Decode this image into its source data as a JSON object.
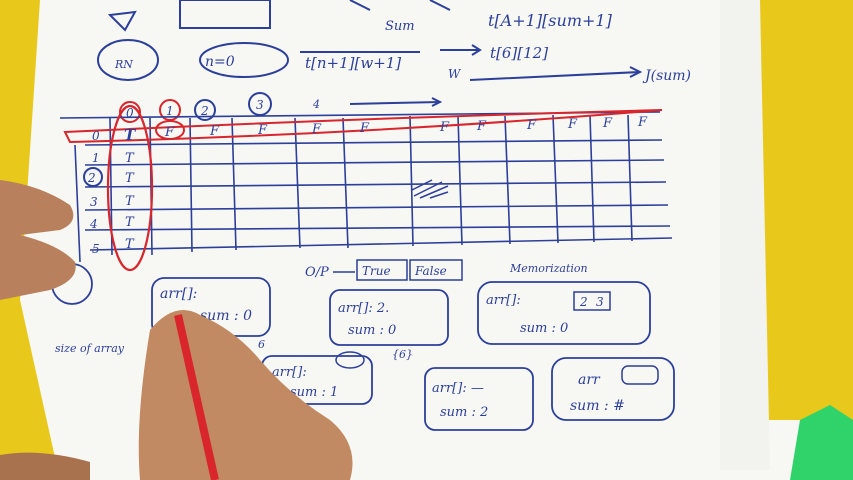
{
  "colors": {
    "background": "#e8c81a",
    "paper": "#f7f7f4",
    "ink_blue": "#2c3f9a",
    "ink_red": "#d8262c",
    "marker_green": "#2fd36a"
  },
  "top_notes": {
    "sum_label": "Sum",
    "formula_main": "t[A+1][sum+1]",
    "formula_left": "t[n+1][w+1]",
    "formula_right": "t[6][12]",
    "w_label": "W",
    "j_sum": "J(sum)",
    "n_label": "n=0",
    "circle_label": "RN"
  },
  "table": {
    "col_headers": [
      "0",
      "1",
      "2",
      "3",
      "4"
    ],
    "row_headers": [
      "0",
      "1",
      "2",
      "3",
      "4",
      "5"
    ],
    "row0_values": [
      "T",
      "F",
      "F",
      "F",
      "F",
      "F",
      "F",
      "F",
      "F",
      "F",
      "F",
      "F"
    ],
    "col0_values": [
      "T",
      "T",
      "T",
      "T",
      "T"
    ]
  },
  "output": {
    "label": "O/P",
    "true_text": "True",
    "false_text": "False",
    "memo_label": "Memorization"
  },
  "boxes": {
    "box1_arr": "arr[]:",
    "box1_sum": "sum : 0",
    "box1_arrow": "6",
    "box2_arr": "arr[]: 2.",
    "box2_sum": "sum : 0",
    "box3_arr": "arr[]:",
    "box3_cells": [
      "2",
      "3"
    ],
    "box3_sum": "sum : 0",
    "box4_arr": "arr[]:",
    "box4_sum": "sum : 1",
    "box4_after": "{6}",
    "box5_arr": "arr[]: —",
    "box5_sum": "sum : 2",
    "box6_arr": "arr",
    "box6_sum": "sum : #",
    "size_note": "size of array"
  }
}
